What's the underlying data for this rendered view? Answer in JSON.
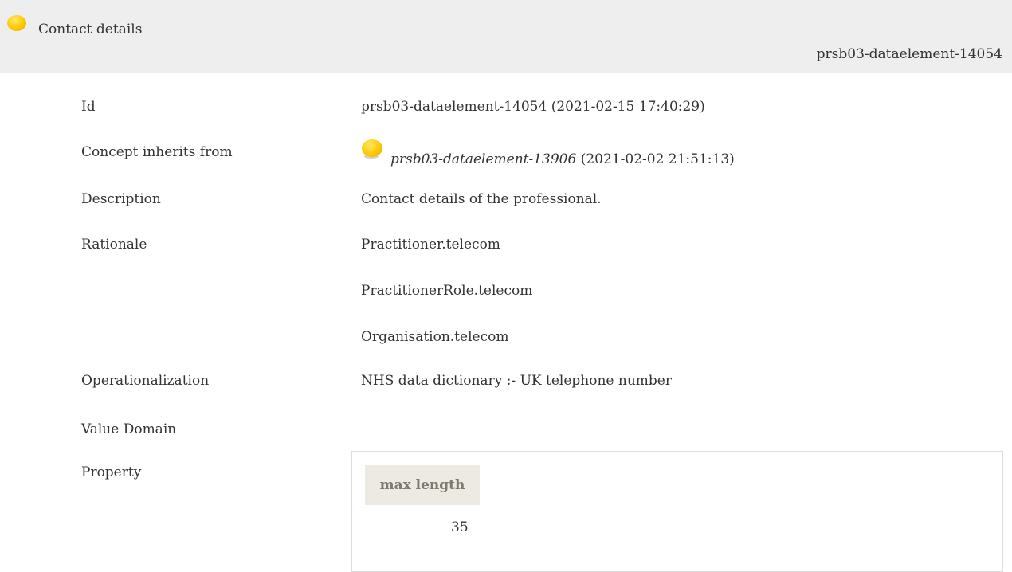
{
  "header": {
    "title": "Contact details",
    "id": "prsb03-dataelement-14054"
  },
  "rows": {
    "id": {
      "label": "Id",
      "value": "prsb03-dataelement-14054 (2021-02-15 17:40:29)"
    },
    "inherits": {
      "label": "Concept inherits from",
      "ref": "prsb03-dataelement-13906",
      "date": " (2021-02-02 21:51:13)"
    },
    "description": {
      "label": "Description",
      "value": "Contact details of the professional."
    },
    "rationale": {
      "label": "Rationale",
      "values": [
        "Practitioner.telecom",
        "PractitionerRole.telecom",
        "Organisation.telecom"
      ]
    },
    "operationalization": {
      "label": "Operationalization",
      "value": "NHS data dictionary :- UK telephone number"
    },
    "value_domain": {
      "label": "Value Domain"
    },
    "property": {
      "label": "Property",
      "header": "max length",
      "value": "35"
    }
  },
  "icons": {
    "status": "yellow-circle-icon"
  },
  "colors": {
    "header_bg": "#eeeeee",
    "bullet": "#ffc800",
    "th_bg": "#ede9e3",
    "th_text": "#7f7a6f"
  }
}
